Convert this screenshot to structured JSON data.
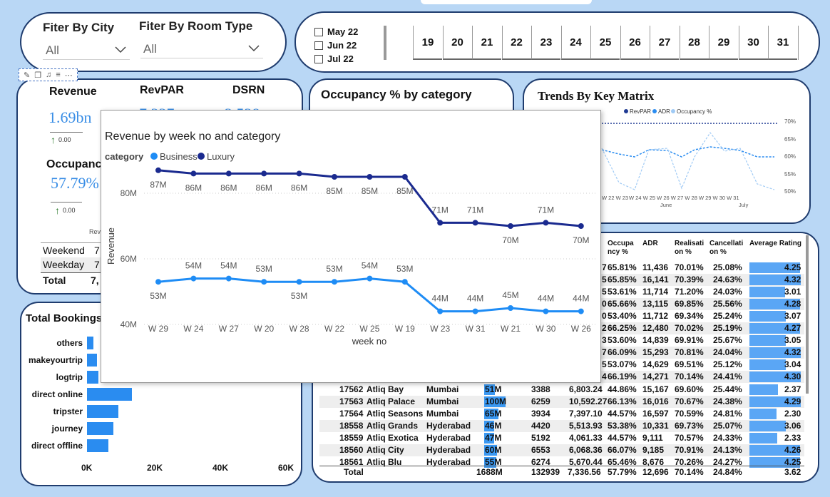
{
  "filters": {
    "city_title": "Fiter By City",
    "city_value": "All",
    "room_title": "Fiter By Room Type",
    "room_value": "All"
  },
  "months": [
    "May 22",
    "Jun 22",
    "Jul 22"
  ],
  "days": [
    "19",
    "20",
    "21",
    "22",
    "23",
    "24",
    "25",
    "26",
    "27",
    "28",
    "29",
    "30",
    "31"
  ],
  "toolbar_icons": [
    "pin-icon",
    "copy-icon",
    "bell-icon",
    "filter-icon",
    "more-icon"
  ],
  "kpi": {
    "revenue_label": "Revenue",
    "revenue_value": "1.69bn",
    "revenue_delta": "0.00",
    "revpar_label": "RevPAR",
    "revpar_value": "7,337",
    "dsrn_label": "DSRN",
    "dsrn_value": "2,528",
    "occupancy_label": "Occupancy",
    "occupancy_value": "57.79%",
    "occupancy_delta": "0.00",
    "table_col": "Rev",
    "rows": [
      {
        "label": "Weekend",
        "value": "7"
      },
      {
        "label": "Weekday",
        "value": "7"
      },
      {
        "label": "Total",
        "value": "7,"
      }
    ]
  },
  "occupancy_card": {
    "title": "Occupancy % by category"
  },
  "trends": {
    "title": "Trends By Key Matrix",
    "legend": [
      "RevPAR",
      "ADR",
      "Occupancy %"
    ],
    "y_ticks": [
      "70%",
      "65%",
      "60%",
      "55%",
      "50%"
    ],
    "x_ticks": [
      "W 22",
      "W 23",
      "W 24",
      "W 25",
      "W 26",
      "W 27",
      "W 28",
      "W 29",
      "W 30",
      "W 31"
    ],
    "x_prefix_tick": "W 22 W 23",
    "months": [
      "June",
      "July"
    ],
    "colors": {
      "revpar": "#1f3a93",
      "adr": "#2a8cf0",
      "occ": "#9fcaf5"
    }
  },
  "bookings": {
    "title": "Total Bookings b",
    "categories": [
      "others",
      "makeyourtrip",
      "logtrip",
      "direct online",
      "tripster",
      "journey",
      "direct offline"
    ],
    "values": [
      2000,
      3000,
      3500,
      13800,
      9500,
      8000,
      6600
    ],
    "axis_ticks": [
      "0K",
      "20K",
      "40K",
      "60K"
    ]
  },
  "table": {
    "headers": [
      "Occupa ncy %",
      "ADR",
      "Realisati on %",
      "Cancellati on %",
      "Average Rating"
    ],
    "top_rows": [
      {
        "c": "7",
        "occ": "65.81%",
        "adr": "11,436",
        "real": "70.01%",
        "canc": "25.08%",
        "rating": "4.25"
      },
      {
        "c": "5",
        "occ": "65.85%",
        "adr": "16,141",
        "real": "70.39%",
        "canc": "24.63%",
        "rating": "4.32"
      },
      {
        "c": "5",
        "occ": "53.61%",
        "adr": "11,714",
        "real": "71.20%",
        "canc": "24.03%",
        "rating": "3.01"
      },
      {
        "c": "0",
        "occ": "65.66%",
        "adr": "13,115",
        "real": "69.85%",
        "canc": "25.56%",
        "rating": "4.28"
      },
      {
        "c": "0",
        "occ": "53.40%",
        "adr": "11,712",
        "real": "69.34%",
        "canc": "25.24%",
        "rating": "3.07"
      },
      {
        "c": "2",
        "occ": "66.25%",
        "adr": "12,480",
        "real": "70.02%",
        "canc": "25.19%",
        "rating": "4.27"
      },
      {
        "c": "3",
        "occ": "53.60%",
        "adr": "14,839",
        "real": "69.91%",
        "canc": "25.67%",
        "rating": "3.05"
      },
      {
        "c": "7",
        "occ": "66.09%",
        "adr": "15,293",
        "real": "70.81%",
        "canc": "24.04%",
        "rating": "4.32"
      },
      {
        "c": "5",
        "occ": "53.07%",
        "adr": "14,629",
        "real": "69.51%",
        "canc": "25.12%",
        "rating": "3.04"
      },
      {
        "c": "4",
        "occ": "66.19%",
        "adr": "14,271",
        "real": "70.14%",
        "canc": "24.41%",
        "rating": "4.30"
      }
    ],
    "rows": [
      {
        "id": "17562",
        "name": "Atliq Bay",
        "city": "Mumbai",
        "rev": "51M",
        "rev_share": 0.51,
        "bookings": "3388",
        "revpar": "6,803.24",
        "occ": "44.86%",
        "adr": "15,167",
        "real": "69.60%",
        "canc": "25.44%",
        "rating": "2.37"
      },
      {
        "id": "17563",
        "name": "Atliq Palace",
        "city": "Mumbai",
        "rev": "100M",
        "rev_share": 1.0,
        "bookings": "6259",
        "revpar": "10,592.27",
        "occ": "66.13%",
        "adr": "16,016",
        "real": "70.67%",
        "canc": "24.38%",
        "rating": "4.29"
      },
      {
        "id": "17564",
        "name": "Atliq Seasons",
        "city": "Mumbai",
        "rev": "65M",
        "rev_share": 0.65,
        "bookings": "3934",
        "revpar": "7,397.10",
        "occ": "44.57%",
        "adr": "16,597",
        "real": "70.59%",
        "canc": "24.81%",
        "rating": "2.30"
      },
      {
        "id": "18558",
        "name": "Atliq Grands",
        "city": "Hyderabad",
        "rev": "46M",
        "rev_share": 0.46,
        "bookings": "4420",
        "revpar": "5,513.93",
        "occ": "53.38%",
        "adr": "10,331",
        "real": "69.73%",
        "canc": "25.07%",
        "rating": "3.06"
      },
      {
        "id": "18559",
        "name": "Atliq Exotica",
        "city": "Hyderabad",
        "rev": "47M",
        "rev_share": 0.47,
        "bookings": "5192",
        "revpar": "4,061.33",
        "occ": "44.57%",
        "adr": "9,111",
        "real": "70.57%",
        "canc": "24.33%",
        "rating": "2.33"
      },
      {
        "id": "18560",
        "name": "Atliq City",
        "city": "Hyderabad",
        "rev": "60M",
        "rev_share": 0.6,
        "bookings": "6553",
        "revpar": "6,068.36",
        "occ": "66.07%",
        "adr": "9,185",
        "real": "70.91%",
        "canc": "24.13%",
        "rating": "4.26"
      },
      {
        "id": "18561",
        "name": "Atliq Blu",
        "city": "Hyderabad",
        "rev": "55M",
        "rev_share": 0.55,
        "bookings": "6274",
        "revpar": "5,670.44",
        "occ": "65.46%",
        "adr": "8,676",
        "real": "70.26%",
        "canc": "24.27%",
        "rating": "4.25"
      }
    ],
    "total": {
      "label": "Total",
      "rev": "1688M",
      "bookings": "132939",
      "revpar": "7,336.56",
      "occ": "57.79%",
      "adr": "12,696",
      "real": "70.14%",
      "canc": "24.84%",
      "rating": "3.62"
    }
  },
  "chart_data": {
    "type": "line",
    "title": "Revenue by week no and category",
    "legend_title": "category",
    "xlabel": "week no",
    "ylabel": "Revenue",
    "categories": [
      "W 29",
      "W 24",
      "W 27",
      "W 20",
      "W 28",
      "W 22",
      "W 25",
      "W 19",
      "W 23",
      "W 31",
      "W 21",
      "W 30",
      "W 26"
    ],
    "y_ticks": [
      "80M",
      "60M",
      "40M"
    ],
    "ylim": [
      40,
      90
    ],
    "grid": true,
    "series": [
      {
        "name": "Luxury",
        "color": "#1a2a8f",
        "values": [
          87,
          86,
          86,
          86,
          86,
          85,
          85,
          85,
          71,
          71,
          70,
          71,
          70
        ],
        "labels": [
          "87M",
          "86M",
          "86M",
          "86M",
          "86M",
          "85M",
          "85M",
          "85M",
          "71M",
          "71M",
          "70M",
          "71M",
          "70M"
        ]
      },
      {
        "name": "Business",
        "color": "#1e8cf5",
        "values": [
          53,
          54,
          54,
          53,
          53,
          53,
          54,
          53,
          44,
          44,
          45,
          44,
          44
        ],
        "labels": [
          "53M",
          "54M",
          "54M",
          "53M",
          "53M",
          "53M",
          "54M",
          "53M",
          "44M",
          "44M",
          "45M",
          "44M",
          "44M"
        ]
      }
    ]
  }
}
